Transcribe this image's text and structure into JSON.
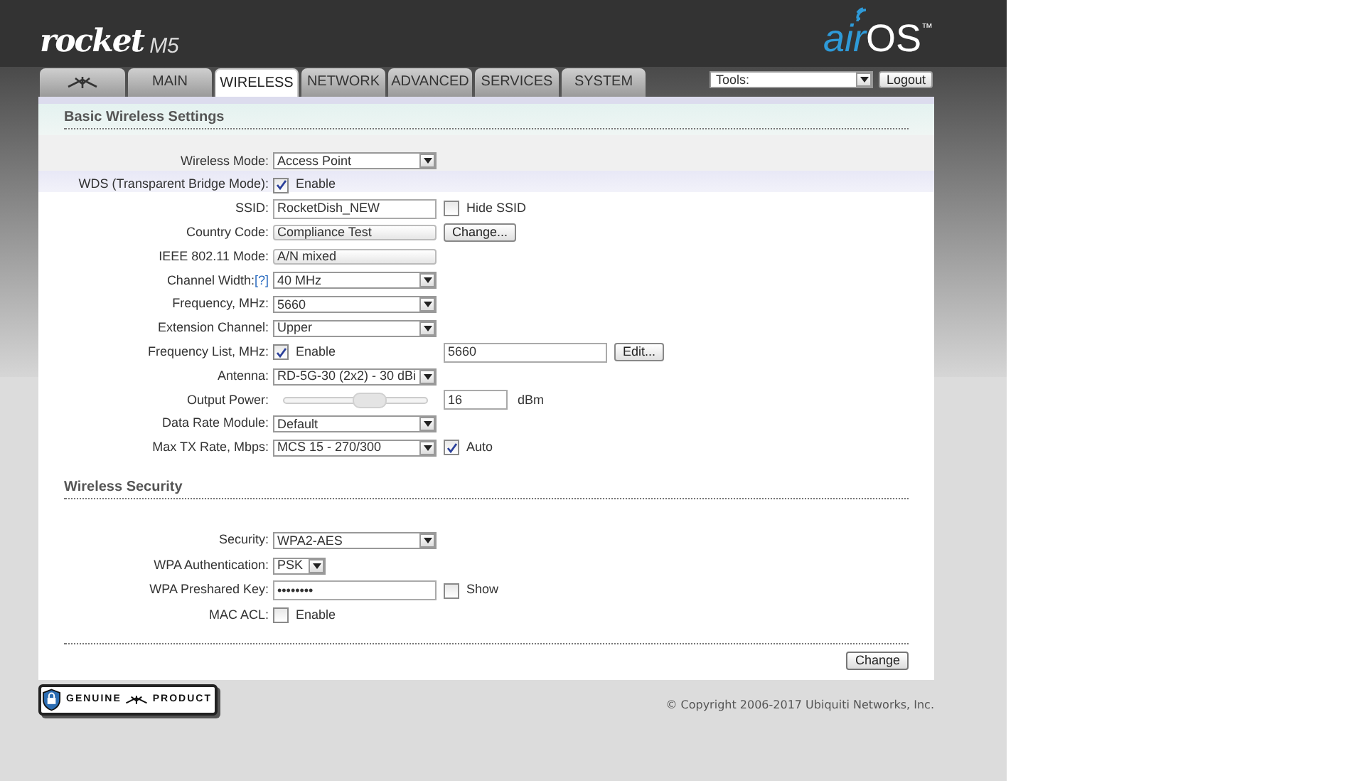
{
  "header": {
    "logo": "rocket",
    "model": "M5",
    "brand": "air",
    "brand_os": "OS",
    "trademark": "™"
  },
  "tabs": [
    {
      "kind": "icon",
      "selected": false
    },
    {
      "kind": "text",
      "label": "MAIN",
      "selected": false
    },
    {
      "kind": "text",
      "label": "WIRELESS",
      "selected": true
    },
    {
      "kind": "text",
      "label": "NETWORK",
      "selected": false
    },
    {
      "kind": "text",
      "label": "ADVANCED",
      "selected": false
    },
    {
      "kind": "text",
      "label": "SERVICES",
      "selected": false
    },
    {
      "kind": "text",
      "label": "SYSTEM",
      "selected": false
    }
  ],
  "tools": {
    "value": "Tools:"
  },
  "logout": "Logout",
  "sections": [
    {
      "title": "Basic Wireless Settings",
      "rows": [
        {
          "label": "Wireless Mode:",
          "controls": [
            {
              "kind": "select",
              "value": "Access Point"
            }
          ]
        },
        {
          "label": "WDS (Transparent Bridge Mode):",
          "controls": [
            {
              "kind": "checkbox",
              "checked": true,
              "label": "Enable"
            }
          ]
        },
        {
          "label": "SSID:",
          "controls": [
            {
              "kind": "text",
              "value": "RocketDish_NEW"
            },
            {
              "kind": "checkbox",
              "checked": false,
              "label": "Hide SSID"
            }
          ]
        },
        {
          "label": "Country Code:",
          "controls": [
            {
              "kind": "readonly",
              "value": "Compliance Test"
            },
            {
              "kind": "button",
              "label": "Change..."
            }
          ]
        },
        {
          "label": "IEEE 802.11 Mode:",
          "controls": [
            {
              "kind": "readonly",
              "value": "A/N mixed"
            }
          ]
        },
        {
          "label": "Channel Width:",
          "help": "[?]",
          "controls": [
            {
              "kind": "select",
              "value": "40 MHz"
            }
          ]
        },
        {
          "label": "Frequency, MHz:",
          "controls": [
            {
              "kind": "select",
              "value": "5660"
            }
          ]
        },
        {
          "label": "Extension Channel:",
          "controls": [
            {
              "kind": "select",
              "value": "Upper"
            }
          ]
        },
        {
          "label": "Frequency List, MHz:",
          "controls": [
            {
              "kind": "checkbox",
              "checked": true,
              "label": "Enable"
            },
            {
              "kind": "text",
              "value": "5660"
            },
            {
              "kind": "button",
              "label": "Edit..."
            }
          ]
        },
        {
          "label": "Antenna:",
          "controls": [
            {
              "kind": "select",
              "value": "RD-5G-30 (2x2) - 30 dBi"
            }
          ]
        },
        {
          "label": "Output Power:",
          "controls": [
            {
              "kind": "slider",
              "level": 0.6
            },
            {
              "kind": "number",
              "value": "16"
            },
            {
              "kind": "unit",
              "label": "dBm"
            }
          ]
        },
        {
          "label": "Data Rate Module:",
          "controls": [
            {
              "kind": "select",
              "value": "Default"
            }
          ]
        },
        {
          "label": "Max TX Rate, Mbps:",
          "controls": [
            {
              "kind": "select",
              "value": "MCS 15 - 270/300"
            },
            {
              "kind": "checkbox",
              "checked": true,
              "label": "Auto"
            }
          ]
        }
      ]
    },
    {
      "title": "Wireless Security",
      "rows": [
        {
          "label": "Security:",
          "controls": [
            {
              "kind": "select",
              "value": "WPA2-AES"
            }
          ]
        },
        {
          "label": "WPA Authentication:",
          "controls": [
            {
              "kind": "select-short",
              "value": "PSK"
            }
          ]
        },
        {
          "label": "WPA Preshared Key:",
          "controls": [
            {
              "kind": "text",
              "value": "••••••••"
            },
            {
              "kind": "checkbox",
              "checked": false,
              "label": "Show"
            }
          ]
        },
        {
          "label": "MAC ACL:",
          "controls": [
            {
              "kind": "checkbox",
              "checked": false,
              "label": "Enable"
            }
          ]
        }
      ]
    }
  ],
  "change_button": "Change",
  "badge": {
    "left": "GENUINE",
    "right": "PRODUCT"
  },
  "copyright": "© Copyright 2006-2017 Ubiquiti Networks, Inc."
}
